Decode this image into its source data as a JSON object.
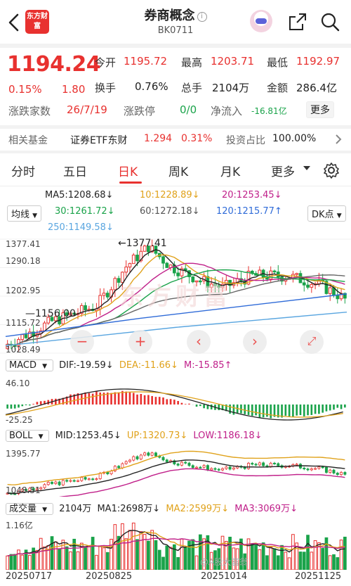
{
  "header": {
    "logo_text": "东方财富",
    "title": "券商概念",
    "subtitle": "BK0711"
  },
  "quote": {
    "price": "1194.24",
    "change_pct": "0.15%",
    "change": "1.80",
    "open_label": "今开",
    "open": "1195.72",
    "high_label": "最高",
    "high": "1203.71",
    "low_label": "最低",
    "low": "1192.97",
    "turnover_label": "换手",
    "turnover": "0.76%",
    "volume_label": "总手",
    "volume": "2104万",
    "amount_label": "金额",
    "amount": "286.4亿",
    "breadth_label": "涨跌家数",
    "breadth": "26/7/19",
    "limit_label": "涨跌停",
    "limit": "0/0",
    "inflow_label": "净流入",
    "inflow": "-16.81亿",
    "more_label": "更多"
  },
  "fund": {
    "label": "相关基金",
    "name": "证券ETF东财",
    "price": "1.294",
    "pct": "0.31%",
    "ratio_label": "投资占比",
    "ratio": "100.00%"
  },
  "tabs": [
    "分时",
    "五日",
    "日K",
    "周K",
    "月K",
    "更多"
  ],
  "ma": {
    "ma5": "MA5:1208.68↓",
    "ma10": "10:1228.89↓",
    "ma20": "20:1253.45↓",
    "ma30": "30:1261.72↓",
    "ma60": "60:1272.18↓",
    "ma120": "120:1215.77↑",
    "ma250": "250:1149.58↓",
    "line_select": "均线",
    "dk_button": "DK点"
  },
  "kline": {
    "y_top": "1377.41",
    "y_mid1": "1290.18",
    "y_mid2": "1202.95",
    "y_mid3": "1115.72",
    "y_bottom": "1028.49",
    "high_mark": "1377.41",
    "low_mark": "1156.00",
    "watermark": "东方财富"
  },
  "macd": {
    "label": "MACD",
    "dif": "DIF:-19.59↓",
    "dea": "DEA:-11.66↓",
    "m": "M:-15.85↑",
    "y_top": "46.10",
    "y_bottom": "-25.25"
  },
  "boll": {
    "label": "BOLL",
    "mid": "MID:1253.45↓",
    "up": "UP:1320.73↓",
    "low": "LOW:1186.18↓",
    "y_top": "1395.77",
    "y_bottom": "1048.51"
  },
  "vol": {
    "label": "成交量",
    "value": "2104万",
    "ma1": "MA1:2698万↓",
    "ma2": "MA2:2599万↓",
    "ma3": "MA3:3069万↓",
    "y_top": "1.16亿",
    "watermark": "@A股大富翁"
  },
  "dates": [
    "20250717",
    "20250825",
    "20251014",
    "20251125"
  ],
  "colors": {
    "up": "#e8312f",
    "down": "#1aa34a",
    "ma5": "#222222",
    "ma10": "#e0a21b",
    "ma20": "#c0208a",
    "ma30": "#1aa34a",
    "ma60": "#666666",
    "ma120": "#2f6bd8",
    "ma250": "#5aa6e0"
  }
}
